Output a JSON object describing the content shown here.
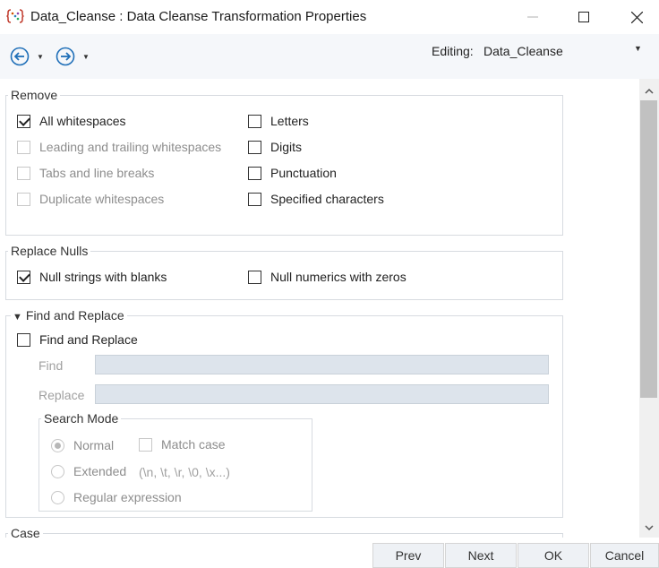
{
  "window": {
    "title": "Data_Cleanse : Data Cleanse Transformation Properties"
  },
  "toolbar": {
    "editing_label": "Editing:",
    "editing_value": "Data_Cleanse"
  },
  "remove": {
    "title": "Remove",
    "left": [
      {
        "label": "All whitespaces",
        "checked": true,
        "enabled": true
      },
      {
        "label": "Leading and trailing whitespaces",
        "checked": false,
        "enabled": false
      },
      {
        "label": "Tabs and line breaks",
        "checked": false,
        "enabled": false
      },
      {
        "label": "Duplicate whitespaces",
        "checked": false,
        "enabled": false
      }
    ],
    "right": [
      {
        "label": "Letters",
        "checked": false,
        "enabled": true
      },
      {
        "label": "Digits",
        "checked": false,
        "enabled": true
      },
      {
        "label": "Punctuation",
        "checked": false,
        "enabled": true
      },
      {
        "label": "Specified characters",
        "checked": false,
        "enabled": true
      }
    ]
  },
  "replace_nulls": {
    "title": "Replace Nulls",
    "strings_label": "Null strings with blanks",
    "strings_checked": true,
    "numerics_label": "Null numerics with zeros",
    "numerics_checked": false
  },
  "find_replace": {
    "title": "Find and Replace",
    "checkbox_label": "Find and Replace",
    "find_label": "Find",
    "find_value": "",
    "replace_label": "Replace",
    "replace_value": "",
    "search_mode": {
      "title": "Search Mode",
      "normal": "Normal",
      "extended": "Extended",
      "extended_hint": "(\\n, \\t, \\r, \\0, \\x...)",
      "regex": "Regular expression",
      "match_case": "Match case",
      "selected": "Normal"
    }
  },
  "case_section": {
    "title": "Case"
  },
  "buttons": {
    "prev": "Prev",
    "next": "Next",
    "ok": "OK",
    "cancel": "Cancel"
  }
}
